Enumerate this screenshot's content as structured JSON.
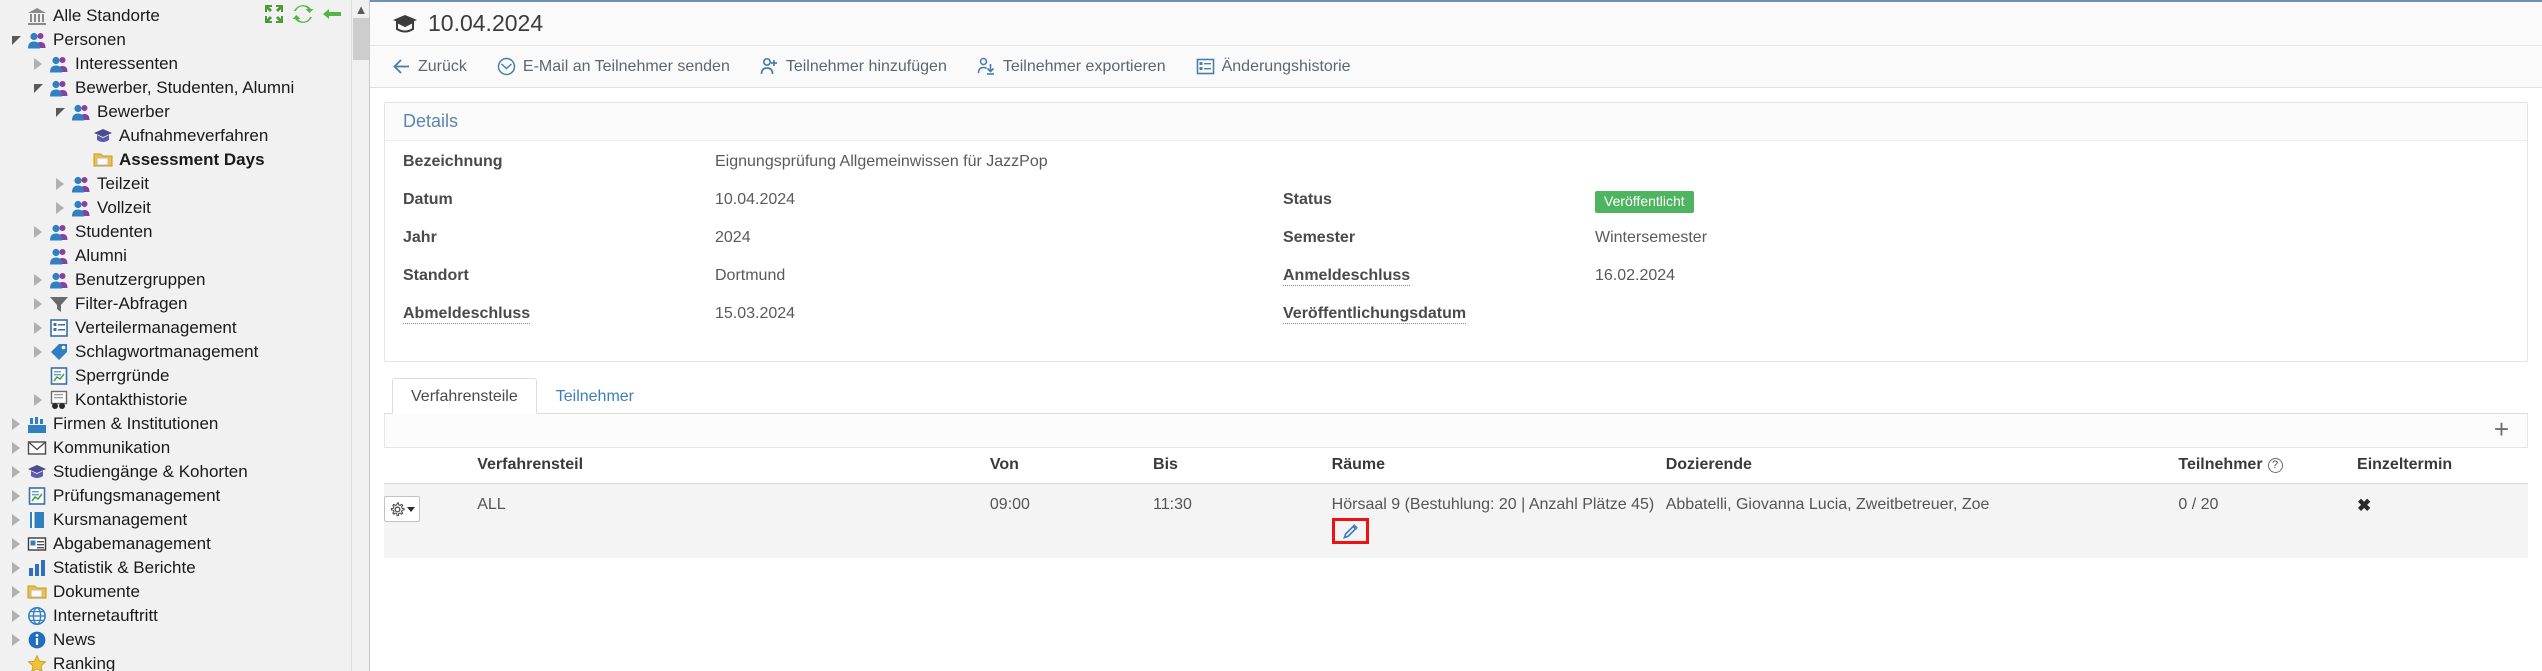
{
  "sidebar": {
    "tools": [
      {
        "name": "collapse-all-icon",
        "label": "Alle einklappen"
      },
      {
        "name": "refresh-icon",
        "label": "Aktualisieren"
      },
      {
        "name": "back-arrow-icon",
        "label": "Zurück"
      }
    ],
    "items": [
      {
        "label": "Alle Standorte",
        "depth": 0,
        "twisty": "none",
        "icon": "bank-icon",
        "bold": false
      },
      {
        "label": "Personen",
        "depth": 0,
        "twisty": "expanded",
        "icon": "people-icon",
        "bold": false
      },
      {
        "label": "Interessenten",
        "depth": 1,
        "twisty": "collapsed",
        "icon": "people-icon",
        "bold": false
      },
      {
        "label": "Bewerber, Studenten, Alumni",
        "depth": 1,
        "twisty": "expanded",
        "icon": "people-icon",
        "bold": false
      },
      {
        "label": "Bewerber",
        "depth": 2,
        "twisty": "expanded",
        "icon": "people-icon",
        "bold": false
      },
      {
        "label": "Aufnahmeverfahren",
        "depth": 3,
        "twisty": "none",
        "icon": "graduation-cap-icon",
        "bold": false
      },
      {
        "label": "Assessment Days",
        "depth": 3,
        "twisty": "none",
        "icon": "folder-icon",
        "bold": true
      },
      {
        "label": "Teilzeit",
        "depth": 2,
        "twisty": "collapsed",
        "icon": "people-icon",
        "bold": false
      },
      {
        "label": "Vollzeit",
        "depth": 2,
        "twisty": "collapsed",
        "icon": "people-icon",
        "bold": false
      },
      {
        "label": "Studenten",
        "depth": 1,
        "twisty": "collapsed",
        "icon": "people-icon",
        "bold": false
      },
      {
        "label": "Alumni",
        "depth": 1,
        "twisty": "none",
        "icon": "people-icon",
        "bold": false
      },
      {
        "label": "Benutzergruppen",
        "depth": 1,
        "twisty": "collapsed",
        "icon": "people-icon",
        "bold": false
      },
      {
        "label": "Filter-Abfragen",
        "depth": 1,
        "twisty": "collapsed",
        "icon": "funnel-icon",
        "bold": false
      },
      {
        "label": "Verteilermanagement",
        "depth": 1,
        "twisty": "collapsed",
        "icon": "list-icon",
        "bold": false
      },
      {
        "label": "Schlagwortmanagement",
        "depth": 1,
        "twisty": "collapsed",
        "icon": "tag-icon",
        "bold": false
      },
      {
        "label": "Sperrgründe",
        "depth": 1,
        "twisty": "none",
        "icon": "report-icon",
        "bold": false
      },
      {
        "label": "Kontakthistorie",
        "depth": 1,
        "twisty": "collapsed",
        "icon": "binoculars-icon",
        "bold": false
      },
      {
        "label": "Firmen & Institutionen",
        "depth": 0,
        "twisty": "collapsed",
        "icon": "factory-icon",
        "bold": false
      },
      {
        "label": "Kommunikation",
        "depth": 0,
        "twisty": "collapsed",
        "icon": "envelope-icon",
        "bold": false
      },
      {
        "label": "Studiengänge & Kohorten",
        "depth": 0,
        "twisty": "collapsed",
        "icon": "graduation-cap-icon",
        "bold": false
      },
      {
        "label": "Prüfungsmanagement",
        "depth": 0,
        "twisty": "collapsed",
        "icon": "report-icon",
        "bold": false
      },
      {
        "label": "Kursmanagement",
        "depth": 0,
        "twisty": "collapsed",
        "icon": "book-icon",
        "bold": false
      },
      {
        "label": "Abgabemanagement",
        "depth": 0,
        "twisty": "collapsed",
        "icon": "card-icon",
        "bold": false
      },
      {
        "label": "Statistik & Berichte",
        "depth": 0,
        "twisty": "collapsed",
        "icon": "bar-chart-icon",
        "bold": false
      },
      {
        "label": "Dokumente",
        "depth": 0,
        "twisty": "collapsed",
        "icon": "folder-icon",
        "bold": false
      },
      {
        "label": "Internetauftritt",
        "depth": 0,
        "twisty": "collapsed",
        "icon": "globe-icon",
        "bold": false
      },
      {
        "label": "News",
        "depth": 0,
        "twisty": "collapsed",
        "icon": "info-icon",
        "bold": false
      },
      {
        "label": "Ranking",
        "depth": 0,
        "twisty": "none",
        "icon": "star-icon",
        "bold": false
      }
    ]
  },
  "header": {
    "title": "10.04.2024",
    "icon": "graduation-cap-icon"
  },
  "toolbar": {
    "items": [
      {
        "label": "Zurück",
        "icon": "arrow-left-icon"
      },
      {
        "label": "E-Mail an Teilnehmer senden",
        "icon": "envelope-icon"
      },
      {
        "label": "Teilnehmer hinzufügen",
        "icon": "user-plus-icon"
      },
      {
        "label": "Teilnehmer exportieren",
        "icon": "export-icon"
      },
      {
        "label": "Änderungshistorie",
        "icon": "history-list-icon"
      }
    ]
  },
  "details": {
    "section_title": "Details",
    "rows": [
      {
        "left_label": "Bezeichnung",
        "left_dotted": false,
        "left_value": "Eignungsprüfung Allgemeinwissen für JazzPop",
        "right_label": "",
        "right_dotted": false,
        "right_value": "",
        "right_badge": null
      },
      {
        "left_label": "Datum",
        "left_dotted": false,
        "left_value": "10.04.2024",
        "right_label": "Status",
        "right_dotted": false,
        "right_value": "",
        "right_badge": "Veröffentlicht"
      },
      {
        "left_label": "Jahr",
        "left_dotted": false,
        "left_value": "2024",
        "right_label": "Semester",
        "right_dotted": false,
        "right_value": "Wintersemester",
        "right_badge": null
      },
      {
        "left_label": "Standort",
        "left_dotted": false,
        "left_value": "Dortmund",
        "right_label": "Anmeldeschluss",
        "right_dotted": true,
        "right_value": "16.02.2024",
        "right_badge": null
      },
      {
        "left_label": "Abmeldeschluss",
        "left_dotted": true,
        "left_value": "15.03.2024",
        "right_label": "Veröffentlichungsdatum",
        "right_dotted": true,
        "right_value": "",
        "right_badge": null
      }
    ]
  },
  "tabs": [
    {
      "label": "Verfahrensteile",
      "active": true
    },
    {
      "label": "Teilnehmer",
      "active": false
    }
  ],
  "grid": {
    "add_label": "+",
    "columns": [
      {
        "key": "gear",
        "label": ""
      },
      {
        "key": "verfahrensteil",
        "label": "Verfahrensteil"
      },
      {
        "key": "von",
        "label": "Von"
      },
      {
        "key": "bis",
        "label": "Bis"
      },
      {
        "key": "raeume",
        "label": "Räume"
      },
      {
        "key": "dozierende",
        "label": "Dozierende"
      },
      {
        "key": "teilnehmer",
        "label": "Teilnehmer",
        "help": "?"
      },
      {
        "key": "einzeltermin",
        "label": "Einzeltermin"
      }
    ],
    "rows": [
      {
        "verfahrensteil": "ALL",
        "von": "09:00",
        "bis": "11:30",
        "raeume": "Hörsaal 9 (Bestuhlung: 20 | Anzahl Plätze 45)",
        "dozierende": "Abbatelli, Giovanna Lucia, Zweitbetreuer, Zoe",
        "teilnehmer": "0 / 20",
        "einzeltermin": "✖"
      }
    ]
  },
  "colors": {
    "accent_blue": "#3d7ebd",
    "status_green": "#4fb45f",
    "highlight_red": "#ee1111",
    "header_border": "#7191ab"
  }
}
